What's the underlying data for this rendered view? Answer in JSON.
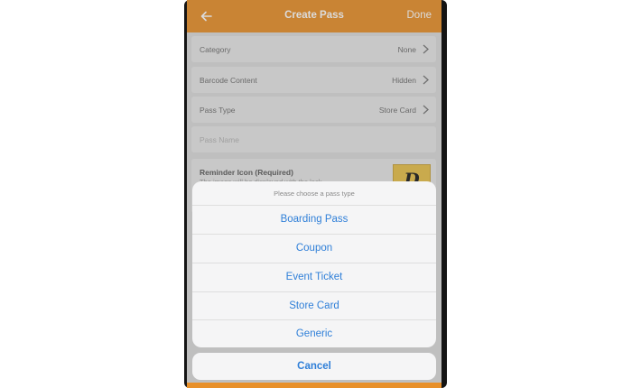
{
  "nav": {
    "title": "Create Pass",
    "done_label": "Done",
    "back_icon": "arrow-left-icon",
    "color": "#e8902a"
  },
  "form": {
    "rows": [
      {
        "label": "Category",
        "value": "None"
      },
      {
        "label": "Barcode Content",
        "value": "Hidden"
      },
      {
        "label": "Pass Type",
        "value": "Store Card"
      }
    ],
    "pass_name_placeholder": "Pass Name",
    "reminder": {
      "title": "Reminder Icon (Required)",
      "subtitle": "The image will be displayed with the lock",
      "logo_letter": "D"
    }
  },
  "action_sheet": {
    "header": "Please choose a pass type",
    "options": [
      "Boarding Pass",
      "Coupon",
      "Event Ticket",
      "Store Card",
      "Generic"
    ],
    "cancel_label": "Cancel",
    "accent": "#2f7fd8"
  }
}
